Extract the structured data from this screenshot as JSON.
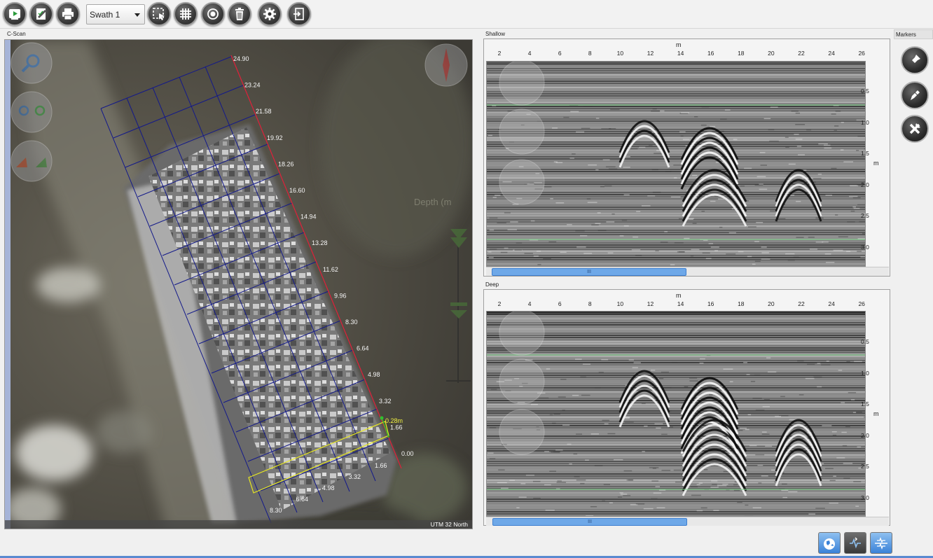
{
  "toolbar": {
    "swath_select": "Swath 1",
    "icons": [
      "start-survey-icon",
      "edit-report-icon",
      "print-icon",
      "select-area-icon",
      "grid-icon",
      "target-icon",
      "trash-icon",
      "settings-icon",
      "exit-icon"
    ]
  },
  "cscan": {
    "label": "C-Scan",
    "projection": "UTM 32 North",
    "depth_label": "Depth (m",
    "offset_value": "0.28m",
    "along_ticks": [
      "24.90",
      "23.24",
      "21.58",
      "19.92",
      "18.26",
      "16.60",
      "14.94",
      "13.28",
      "11.62",
      "9.96",
      "8.30",
      "6.64",
      "4.98",
      "3.32",
      "1.66",
      "0.00"
    ],
    "across_ticks": [
      "1.66",
      "3.32",
      "4.98",
      "6.64",
      "8.30"
    ]
  },
  "shallow": {
    "label": "Shallow",
    "x_unit": "m",
    "x_ticks": [
      "2",
      "4",
      "6",
      "8",
      "10",
      "12",
      "14",
      "16",
      "18",
      "20",
      "22",
      "24",
      "26"
    ],
    "y_unit": "m",
    "y_ticks": [
      "0.5",
      "1.0",
      "1.5",
      "2.0",
      "2.5",
      "3.0"
    ],
    "scroll_thumb": "III"
  },
  "deep": {
    "label": "Deep",
    "x_unit": "m",
    "x_ticks": [
      "2",
      "4",
      "6",
      "8",
      "10",
      "12",
      "14",
      "16",
      "18",
      "20",
      "22",
      "24",
      "26"
    ],
    "y_unit": "m",
    "y_ticks": [
      "0.5",
      "1.0",
      "1.5",
      "2.0",
      "2.5",
      "3.0"
    ],
    "scroll_thumb": "III"
  },
  "markers": {
    "label": "Markers",
    "buttons": [
      "add-marker-icon",
      "edit-marker-icon",
      "delete-marker-icon"
    ]
  },
  "bottom_buttons": [
    "world-view-icon",
    "profile-view-icon",
    "split-view-icon"
  ]
}
